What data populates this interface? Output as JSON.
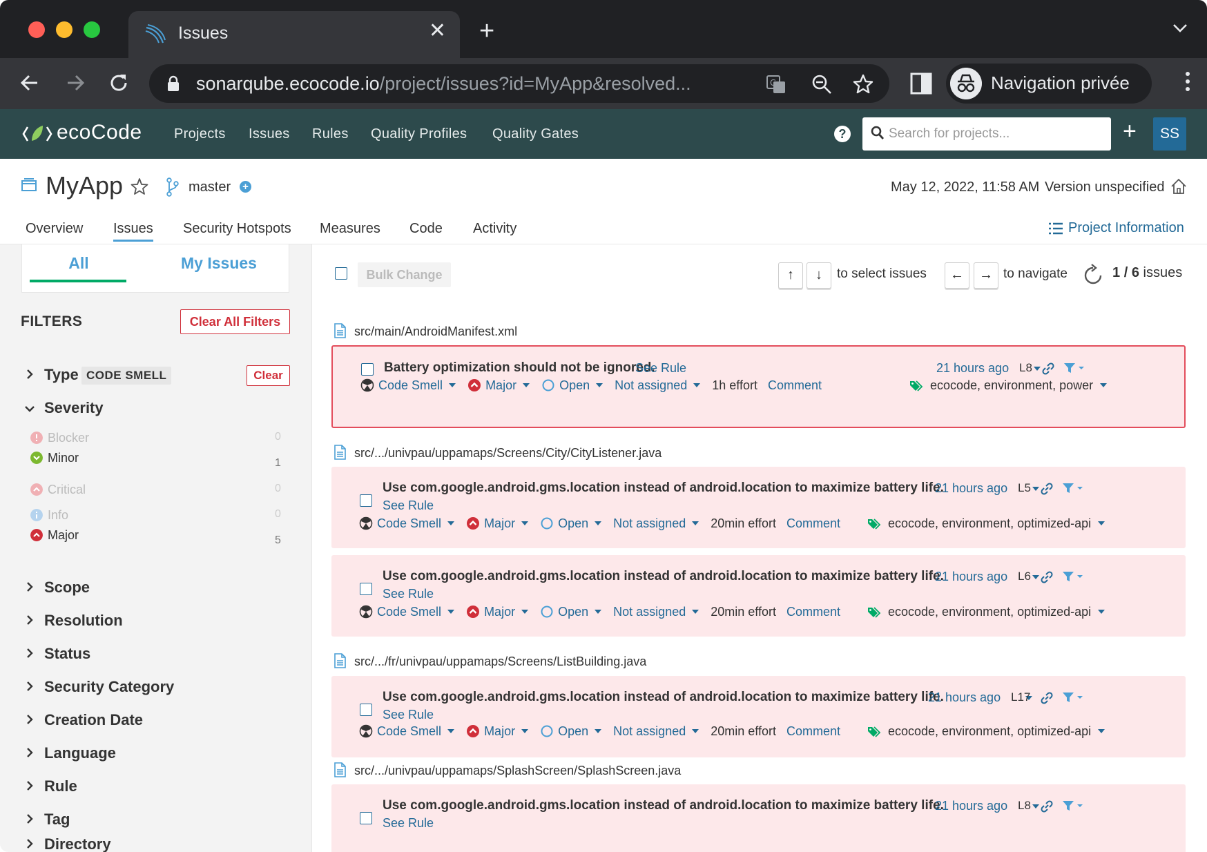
{
  "browser": {
    "tab_title": "Issues",
    "url_host": "sonarqube.ecocode.io",
    "url_path": "/project/issues?id=MyApp&resolved...",
    "incognito_label": "Navigation privée"
  },
  "appnav": {
    "logo_text": "ecoCode",
    "links": [
      "Projects",
      "Issues",
      "Rules",
      "Quality Profiles",
      "Quality Gates"
    ],
    "search_placeholder": "Search for projects...",
    "avatar_initials": "SS",
    "help_glyph": "?"
  },
  "project": {
    "name": "MyApp",
    "branch": "master",
    "date": "May 12, 2022, 11:58 AM",
    "version": "Version unspecified",
    "tabs": [
      "Overview",
      "Issues",
      "Security Hotspots",
      "Measures",
      "Code",
      "Activity"
    ],
    "info_link": "Project Information"
  },
  "sidebar": {
    "scope_all": "All",
    "scope_mine": "My Issues",
    "filters_title": "FILTERS",
    "clear_all": "Clear All Filters",
    "type_label": "Type",
    "type_value": "CODE SMELL",
    "type_clear": "Clear",
    "severity_label": "Severity",
    "severities": [
      {
        "label": "Blocker",
        "count": "0"
      },
      {
        "label": "Minor",
        "count": "1"
      },
      {
        "label": "Critical",
        "count": "0"
      },
      {
        "label": "Info",
        "count": "0"
      },
      {
        "label": "Major",
        "count": "5"
      }
    ],
    "facets": [
      "Scope",
      "Resolution",
      "Status",
      "Security Category",
      "Creation Date",
      "Language",
      "Rule",
      "Tag",
      "Directory"
    ]
  },
  "toolbar": {
    "bulk_change": "Bulk Change",
    "up_key": "↑",
    "down_key": "↓",
    "select_hint": "to select issues",
    "left_key": "←",
    "right_key": "→",
    "navigate_hint": "to navigate",
    "current": "1",
    "total": "6",
    "issues_word": "issues"
  },
  "issues": {
    "files": [
      "src/main/AndroidManifest.xml",
      "src/.../univpau/uppamaps/Screens/City/CityListener.java",
      "src/.../fr/univpau/uppamaps/Screens/ListBuilding.java",
      "src/.../univpau/uppamaps/SplashScreen/SplashScreen.java"
    ],
    "items": [
      {
        "message": "Battery optimization should not be ignored.",
        "see_rule": "See Rule",
        "type": "Code Smell",
        "severity": "Major",
        "status": "Open",
        "assignee": "Not assigned",
        "effort": "1h effort",
        "comment": "Comment",
        "age": "21 hours ago",
        "line": "L8",
        "tags": "ecocode, environment, power"
      },
      {
        "message": "Use com.google.android.gms.location instead of android.location to maximize battery life.",
        "see_rule": "See Rule",
        "type": "Code Smell",
        "severity": "Major",
        "status": "Open",
        "assignee": "Not assigned",
        "effort": "20min effort",
        "comment": "Comment",
        "age": "21 hours ago",
        "line": "L5",
        "tags": "ecocode, environment, optimized-api"
      },
      {
        "message": "Use com.google.android.gms.location instead of android.location to maximize battery life.",
        "see_rule": "See Rule",
        "type": "Code Smell",
        "severity": "Major",
        "status": "Open",
        "assignee": "Not assigned",
        "effort": "20min effort",
        "comment": "Comment",
        "age": "21 hours ago",
        "line": "L6",
        "tags": "ecocode, environment, optimized-api"
      },
      {
        "message": "Use com.google.android.gms.location instead of android.location to maximize battery life.",
        "see_rule": "See Rule",
        "type": "Code Smell",
        "severity": "Major",
        "status": "Open",
        "assignee": "Not assigned",
        "effort": "20min effort",
        "comment": "Comment",
        "age": "21 hours ago",
        "line": "L17",
        "tags": "ecocode, environment, optimized-api"
      },
      {
        "message": "Use com.google.android.gms.location instead of android.location to maximize battery life.",
        "see_rule": "See Rule",
        "age": "21 hours ago",
        "line": "L8"
      }
    ]
  },
  "colors": {
    "nav_bg": "#2d4a4c",
    "link": "#236a97",
    "accent": "#4b9fd5",
    "issue_bg": "#fde8ea",
    "selected_border": "#e34d5c",
    "danger": "#d02f3a"
  }
}
